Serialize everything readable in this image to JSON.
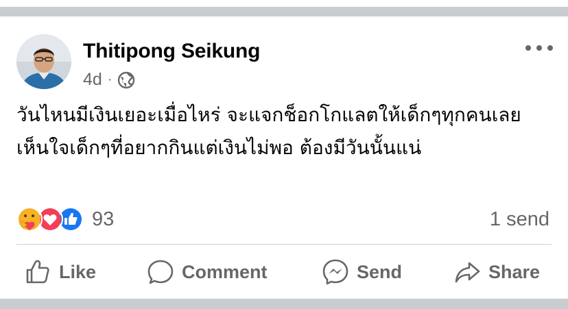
{
  "post": {
    "author": "Thitipong Seikung",
    "time": "4d",
    "separator": "·",
    "audience_icon": "globe-icon",
    "more_icon": "more-horizontal-icon",
    "text": "วันไหนมีเงินเยอะเมื่อไหร่ จะแจกช็อกโกแลตให้เด็กๆทุกคนเลย เห็นใจเด็กๆที่อยากกินแต่เงินไม่พอ  ต้องมีวันนั้นแน่"
  },
  "reactions": {
    "icons": [
      "care-reaction-icon",
      "love-reaction-icon",
      "like-reaction-icon"
    ],
    "count": "93",
    "sends": "1 send"
  },
  "actions": {
    "like": "Like",
    "comment": "Comment",
    "send": "Send",
    "share": "Share"
  },
  "colors": {
    "background": "#ffffff",
    "divider_band": "#c9ccd1",
    "text_primary": "#050505",
    "text_secondary": "#65676b",
    "like_blue": "#1877f2",
    "love_red": "#f33e58",
    "care_yellow": "#f7b125"
  }
}
